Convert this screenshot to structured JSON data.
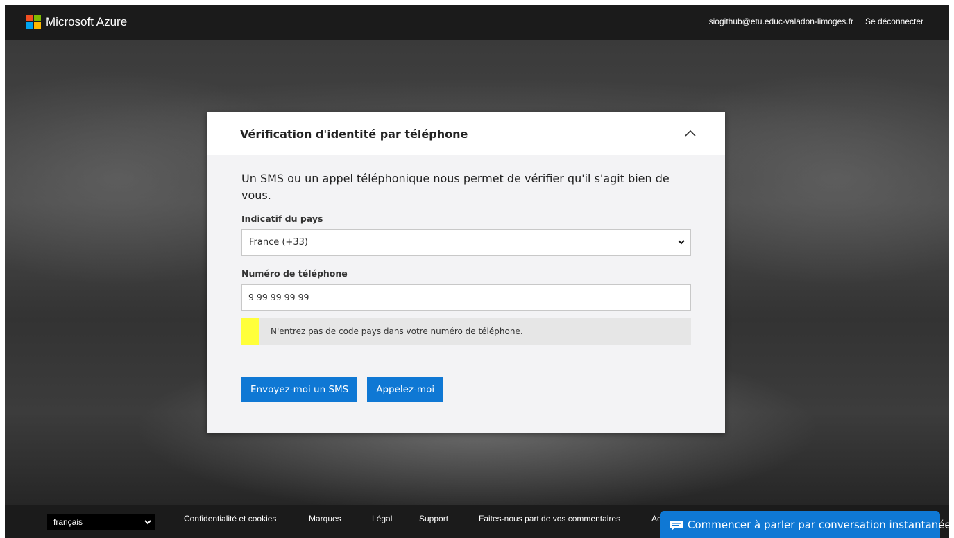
{
  "header": {
    "brand": "Microsoft Azure",
    "user_email": "siogithub@etu.educ-valadon-limoges.fr",
    "signout_label": "Se déconnecter",
    "logo_colors": [
      "#f25022",
      "#7fba00",
      "#00a4ef",
      "#ffb900"
    ]
  },
  "card": {
    "title": "Vérification d'identité par téléphone",
    "intro": "Un SMS ou un appel téléphonique nous permet de vérifier qu'il s'agit bien de vous.",
    "country_label": "Indicatif du pays",
    "country_value": "France (+33)",
    "phone_label": "Numéro de téléphone",
    "phone_value": "9 99 99 99 99",
    "notice": "N'entrez pas de code pays dans votre numéro de téléphone.",
    "sms_button": "Envoyez-moi un SMS",
    "call_button": "Appelez-moi"
  },
  "footer": {
    "language": "français",
    "links": [
      "Confidentialité et cookies",
      "Marques",
      "Légal",
      "Support",
      "Faites-nous part de vos commentaires"
    ],
    "partial_link": "Ac",
    "chat_label": "Commencer à parler par conversation instantanée"
  },
  "colors": {
    "accent": "#0f78d4",
    "notice_marker": "#ffff3a",
    "topbar": "#1b1b1b"
  },
  "icons": [
    "chevron-up-icon",
    "chevron-down-icon",
    "chat-icon"
  ]
}
